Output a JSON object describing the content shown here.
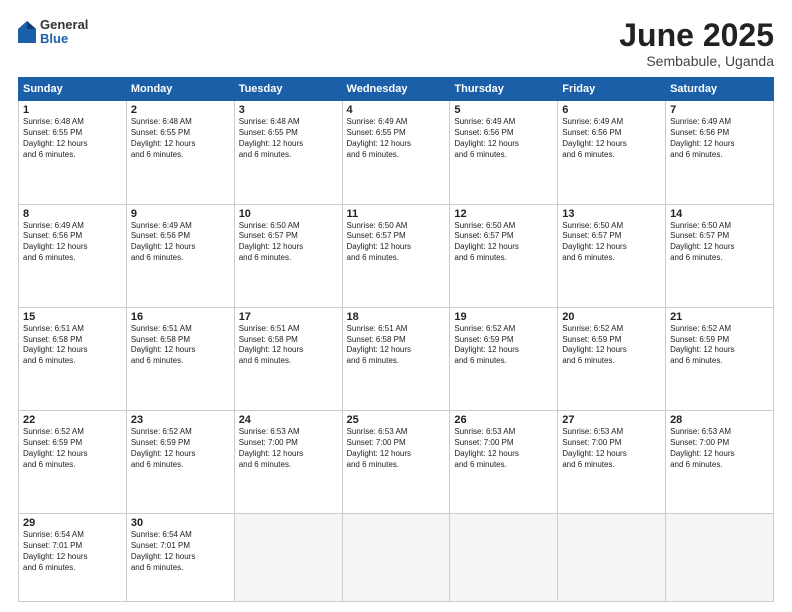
{
  "logo": {
    "general": "General",
    "blue": "Blue"
  },
  "header": {
    "month": "June 2025",
    "location": "Sembabule, Uganda"
  },
  "weekdays": [
    "Sunday",
    "Monday",
    "Tuesday",
    "Wednesday",
    "Thursday",
    "Friday",
    "Saturday"
  ],
  "weeks": [
    [
      {
        "day": "1",
        "info": "Sunrise: 6:48 AM\nSunset: 6:55 PM\nDaylight: 12 hours\nand 6 minutes."
      },
      {
        "day": "2",
        "info": "Sunrise: 6:48 AM\nSunset: 6:55 PM\nDaylight: 12 hours\nand 6 minutes."
      },
      {
        "day": "3",
        "info": "Sunrise: 6:48 AM\nSunset: 6:55 PM\nDaylight: 12 hours\nand 6 minutes."
      },
      {
        "day": "4",
        "info": "Sunrise: 6:49 AM\nSunset: 6:55 PM\nDaylight: 12 hours\nand 6 minutes."
      },
      {
        "day": "5",
        "info": "Sunrise: 6:49 AM\nSunset: 6:56 PM\nDaylight: 12 hours\nand 6 minutes."
      },
      {
        "day": "6",
        "info": "Sunrise: 6:49 AM\nSunset: 6:56 PM\nDaylight: 12 hours\nand 6 minutes."
      },
      {
        "day": "7",
        "info": "Sunrise: 6:49 AM\nSunset: 6:56 PM\nDaylight: 12 hours\nand 6 minutes."
      }
    ],
    [
      {
        "day": "8",
        "info": "Sunrise: 6:49 AM\nSunset: 6:56 PM\nDaylight: 12 hours\nand 6 minutes."
      },
      {
        "day": "9",
        "info": "Sunrise: 6:49 AM\nSunset: 6:56 PM\nDaylight: 12 hours\nand 6 minutes."
      },
      {
        "day": "10",
        "info": "Sunrise: 6:50 AM\nSunset: 6:57 PM\nDaylight: 12 hours\nand 6 minutes."
      },
      {
        "day": "11",
        "info": "Sunrise: 6:50 AM\nSunset: 6:57 PM\nDaylight: 12 hours\nand 6 minutes."
      },
      {
        "day": "12",
        "info": "Sunrise: 6:50 AM\nSunset: 6:57 PM\nDaylight: 12 hours\nand 6 minutes."
      },
      {
        "day": "13",
        "info": "Sunrise: 6:50 AM\nSunset: 6:57 PM\nDaylight: 12 hours\nand 6 minutes."
      },
      {
        "day": "14",
        "info": "Sunrise: 6:50 AM\nSunset: 6:57 PM\nDaylight: 12 hours\nand 6 minutes."
      }
    ],
    [
      {
        "day": "15",
        "info": "Sunrise: 6:51 AM\nSunset: 6:58 PM\nDaylight: 12 hours\nand 6 minutes."
      },
      {
        "day": "16",
        "info": "Sunrise: 6:51 AM\nSunset: 6:58 PM\nDaylight: 12 hours\nand 6 minutes."
      },
      {
        "day": "17",
        "info": "Sunrise: 6:51 AM\nSunset: 6:58 PM\nDaylight: 12 hours\nand 6 minutes."
      },
      {
        "day": "18",
        "info": "Sunrise: 6:51 AM\nSunset: 6:58 PM\nDaylight: 12 hours\nand 6 minutes."
      },
      {
        "day": "19",
        "info": "Sunrise: 6:52 AM\nSunset: 6:59 PM\nDaylight: 12 hours\nand 6 minutes."
      },
      {
        "day": "20",
        "info": "Sunrise: 6:52 AM\nSunset: 6:59 PM\nDaylight: 12 hours\nand 6 minutes."
      },
      {
        "day": "21",
        "info": "Sunrise: 6:52 AM\nSunset: 6:59 PM\nDaylight: 12 hours\nand 6 minutes."
      }
    ],
    [
      {
        "day": "22",
        "info": "Sunrise: 6:52 AM\nSunset: 6:59 PM\nDaylight: 12 hours\nand 6 minutes."
      },
      {
        "day": "23",
        "info": "Sunrise: 6:52 AM\nSunset: 6:59 PM\nDaylight: 12 hours\nand 6 minutes."
      },
      {
        "day": "24",
        "info": "Sunrise: 6:53 AM\nSunset: 7:00 PM\nDaylight: 12 hours\nand 6 minutes."
      },
      {
        "day": "25",
        "info": "Sunrise: 6:53 AM\nSunset: 7:00 PM\nDaylight: 12 hours\nand 6 minutes."
      },
      {
        "day": "26",
        "info": "Sunrise: 6:53 AM\nSunset: 7:00 PM\nDaylight: 12 hours\nand 6 minutes."
      },
      {
        "day": "27",
        "info": "Sunrise: 6:53 AM\nSunset: 7:00 PM\nDaylight: 12 hours\nand 6 minutes."
      },
      {
        "day": "28",
        "info": "Sunrise: 6:53 AM\nSunset: 7:00 PM\nDaylight: 12 hours\nand 6 minutes."
      }
    ],
    [
      {
        "day": "29",
        "info": "Sunrise: 6:54 AM\nSunset: 7:01 PM\nDaylight: 12 hours\nand 6 minutes."
      },
      {
        "day": "30",
        "info": "Sunrise: 6:54 AM\nSunset: 7:01 PM\nDaylight: 12 hours\nand 6 minutes."
      },
      {
        "day": "",
        "info": ""
      },
      {
        "day": "",
        "info": ""
      },
      {
        "day": "",
        "info": ""
      },
      {
        "day": "",
        "info": ""
      },
      {
        "day": "",
        "info": ""
      }
    ]
  ]
}
